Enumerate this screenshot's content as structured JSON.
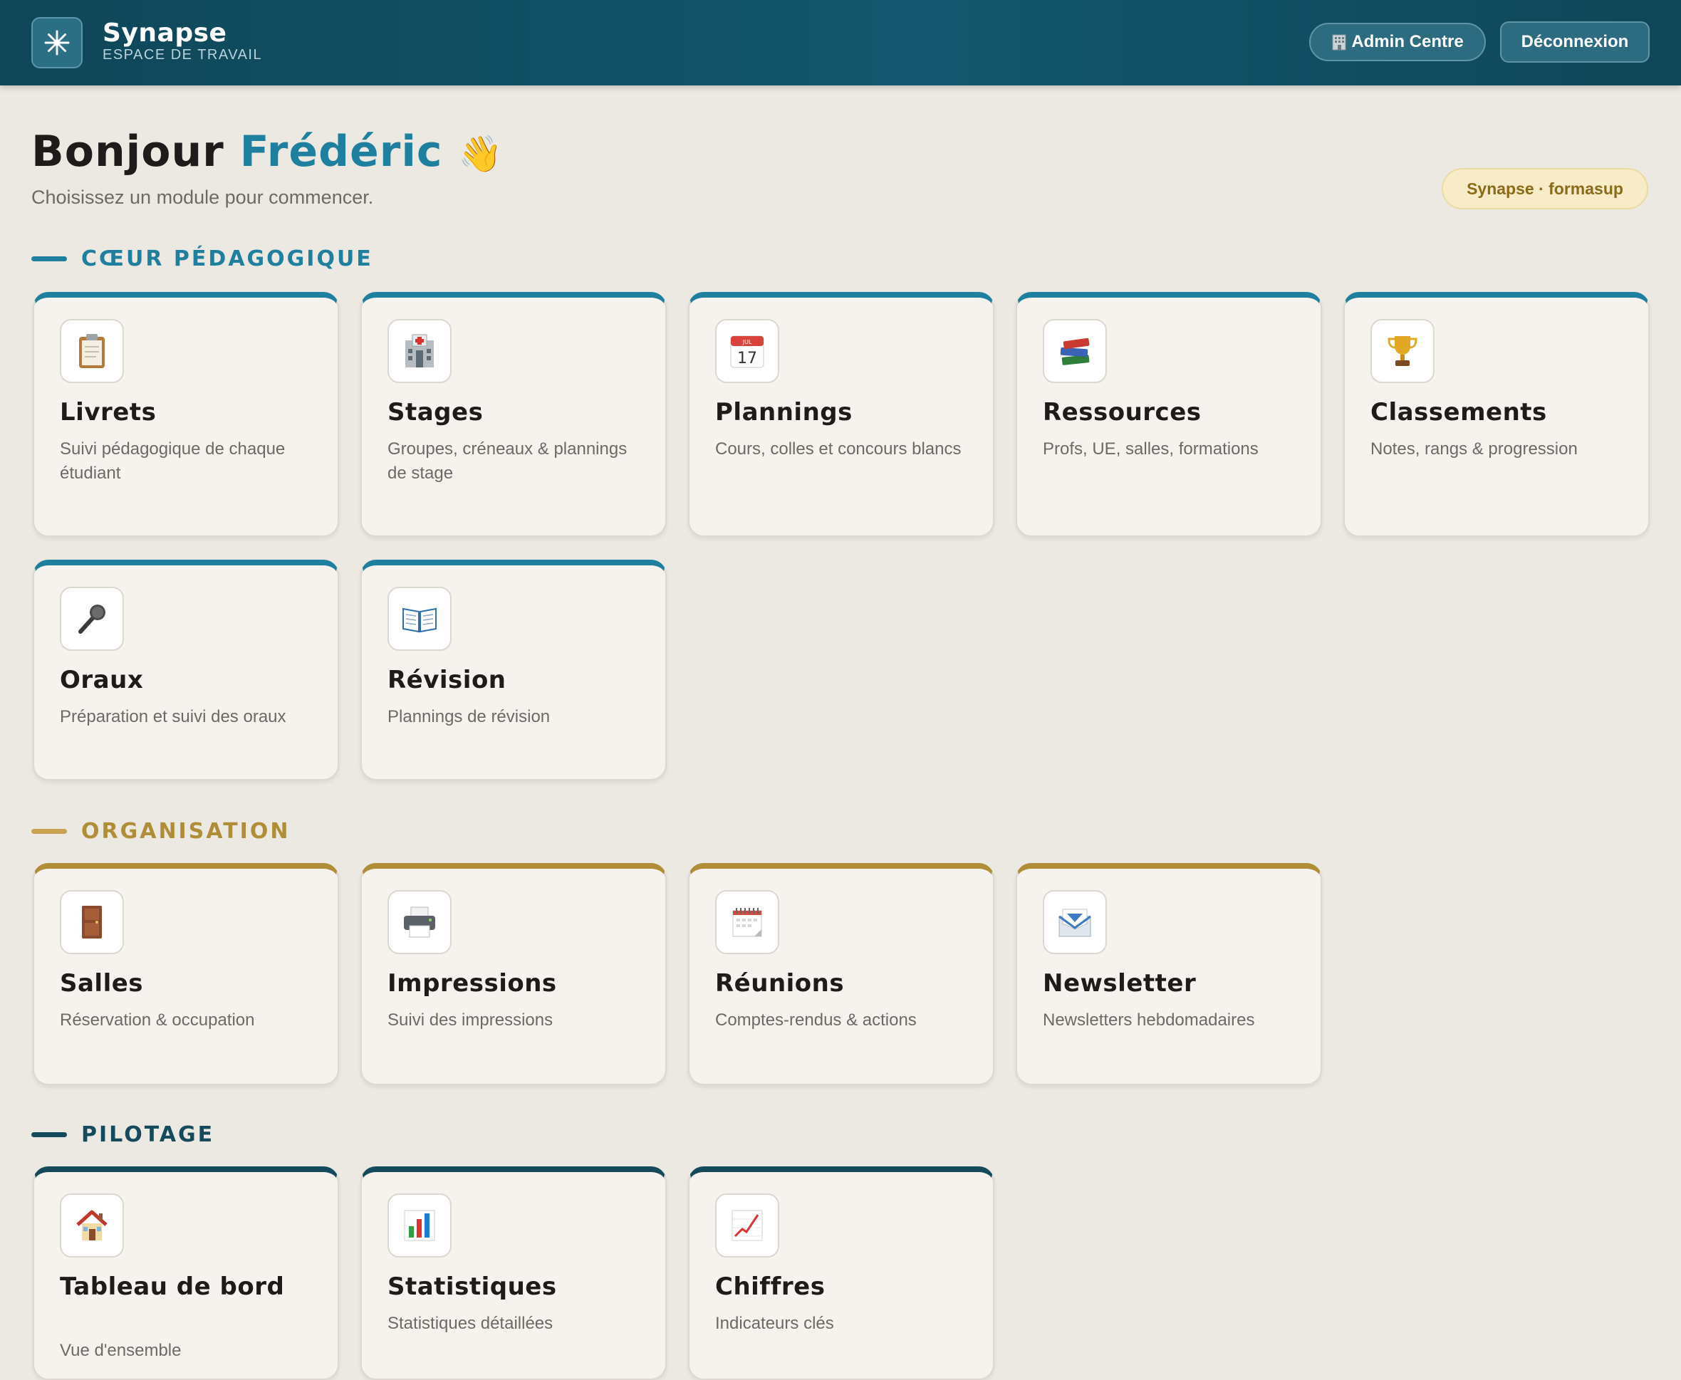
{
  "header": {
    "brand": "Synapse",
    "subtitle": "ESPACE DE TRAVAIL",
    "admin_label": "Admin Centre",
    "logout_label": "Déconnexion"
  },
  "greeting": {
    "hello": "Bonjour",
    "name": "Frédéric",
    "wave": "👋",
    "prompt": "Choisissez un module pour commencer.",
    "badge": "Synapse · formasup"
  },
  "colors": {
    "pedagogique": "#1f7f9f",
    "organisation": "#b08d37",
    "pilotage": "#144a5c"
  },
  "sections": {
    "pedagogique": {
      "title": "CŒUR PÉDAGOGIQUE",
      "cards": [
        {
          "icon": "clipboard-icon",
          "title": "Livrets",
          "desc": "Suivi pédagogique de chaque étudiant"
        },
        {
          "icon": "hospital-icon",
          "title": "Stages",
          "desc": "Groupes, créneaux & plannings de stage"
        },
        {
          "icon": "calendar-icon",
          "title": "Plannings",
          "desc": "Cours, colles et concours blancs",
          "icon_text": "17",
          "icon_month": "JUL"
        },
        {
          "icon": "books-icon",
          "title": "Ressources",
          "desc": "Profs, UE, salles, formations"
        },
        {
          "icon": "trophy-icon",
          "title": "Classements",
          "desc": "Notes, rangs & progression"
        },
        {
          "icon": "microphone-icon",
          "title": "Oraux",
          "desc": "Préparation et suivi des oraux"
        },
        {
          "icon": "open-book-icon",
          "title": "Révision",
          "desc": "Plannings de révision"
        }
      ]
    },
    "organisation": {
      "title": "ORGANISATION",
      "cards": [
        {
          "icon": "door-icon",
          "title": "Salles",
          "desc": "Réservation & occupation"
        },
        {
          "icon": "printer-icon",
          "title": "Impressions",
          "desc": "Suivi des impressions"
        },
        {
          "icon": "spiral-calendar-icon",
          "title": "Réunions",
          "desc": "Comptes-rendus & actions"
        },
        {
          "icon": "envelope-icon",
          "title": "Newsletter",
          "desc": "Newsletters hebdomadaires"
        }
      ]
    },
    "pilotage": {
      "title": "PILOTAGE",
      "cards": [
        {
          "icon": "house-icon",
          "title": "Tableau de bord",
          "desc": "Vue d'ensemble"
        },
        {
          "icon": "bar-chart-icon",
          "title": "Statistiques",
          "desc": "Statistiques détaillées"
        },
        {
          "icon": "line-chart-icon",
          "title": "Chiffres",
          "desc": "Indicateurs clés"
        }
      ]
    }
  }
}
